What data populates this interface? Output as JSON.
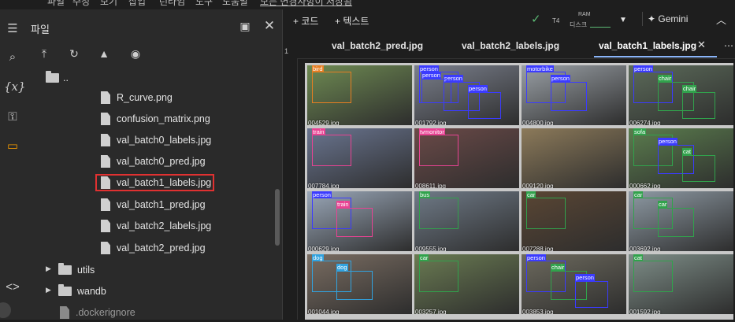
{
  "menu": [
    "파일",
    "수정",
    "보기",
    "삽입",
    "런타임",
    "도구",
    "도움말",
    "모든 변경사항이 저장됨"
  ],
  "rail_icons": [
    "list-icon",
    "search-icon",
    "variables-icon",
    "key-icon",
    "folder-icon",
    "code-icon"
  ],
  "files_panel": {
    "title": "파일",
    "parent": "..",
    "files": [
      "R_curve.png",
      "confusion_matrix.png",
      "val_batch0_labels.jpg",
      "val_batch0_pred.jpg",
      "val_batch1_labels.jpg",
      "val_batch1_pred.jpg",
      "val_batch2_labels.jpg",
      "val_batch2_pred.jpg"
    ],
    "folders": [
      "utils",
      "wandb"
    ],
    "hidden_file": ".dockerignore"
  },
  "toolbar": {
    "code_label": "+ 코드",
    "text_label": "+ 텍스트",
    "runtime": "T4",
    "ram_label": "RAM",
    "disk_label": "디스크",
    "gemini_label": "Gemini"
  },
  "tabs": [
    {
      "label": "val_batch2_pred.jpg"
    },
    {
      "label": "val_batch2_labels.jpg"
    },
    {
      "label": "val_batch1_labels.jpg"
    }
  ],
  "gutter_number": "1",
  "colors": {
    "accent": "#8ab4f8",
    "selection": "#e03131",
    "check": "#5bb974"
  },
  "images": [
    {
      "file": "004529.jpg",
      "bg": "#6e8a52",
      "labels": [
        {
          "t": "bird",
          "c": "#e67e22"
        }
      ]
    },
    {
      "file": "001792.jpg",
      "bg": "#7a7f8c",
      "labels": [
        {
          "t": "person",
          "c": "#3b3bff"
        },
        {
          "t": "person",
          "c": "#3b3bff"
        },
        {
          "t": "person",
          "c": "#3b3bff"
        },
        {
          "t": "person",
          "c": "#3b3bff"
        }
      ]
    },
    {
      "file": "004800.jpg",
      "bg": "#9aa0a6",
      "labels": [
        {
          "t": "motorbike",
          "c": "#3b3bff"
        },
        {
          "t": "person",
          "c": "#3b3bff"
        }
      ]
    },
    {
      "file": "006274.jpg",
      "bg": "#5c6b5a",
      "labels": [
        {
          "t": "person",
          "c": "#3b3bff"
        },
        {
          "t": "chair",
          "c": "#31a24c"
        },
        {
          "t": "chair",
          "c": "#31a24c"
        }
      ]
    },
    {
      "file": "007784.jpg",
      "bg": "#6a7590",
      "labels": [
        {
          "t": "train",
          "c": "#e84393"
        }
      ]
    },
    {
      "file": "008611.jpg",
      "bg": "#6b4a48",
      "labels": [
        {
          "t": "tvmonitor",
          "c": "#e84393"
        }
      ]
    },
    {
      "file": "009120.jpg",
      "bg": "#8c7a5a",
      "labels": []
    },
    {
      "file": "000662.jpg",
      "bg": "#5b7d4e",
      "labels": [
        {
          "t": "sofa",
          "c": "#31a24c"
        },
        {
          "t": "person",
          "c": "#3b3bff"
        },
        {
          "t": "cat",
          "c": "#31a24c"
        }
      ]
    },
    {
      "file": "000629.jpg",
      "bg": "#9aa7b8",
      "labels": [
        {
          "t": "person",
          "c": "#3b3bff"
        },
        {
          "t": "train",
          "c": "#e84393"
        }
      ]
    },
    {
      "file": "009555.jpg",
      "bg": "#6f7a87",
      "labels": [
        {
          "t": "bus",
          "c": "#31a24c"
        }
      ]
    },
    {
      "file": "007288.jpg",
      "bg": "#5a4634",
      "labels": [
        {
          "t": "car",
          "c": "#31a24c"
        }
      ]
    },
    {
      "file": "003692.jpg",
      "bg": "#8e9aa4",
      "labels": [
        {
          "t": "car",
          "c": "#31a24c"
        },
        {
          "t": "car",
          "c": "#31a24c"
        }
      ]
    },
    {
      "file": "001044.jpg",
      "bg": "#7a6d62",
      "labels": [
        {
          "t": "dog",
          "c": "#31a3e0"
        },
        {
          "t": "dog",
          "c": "#31a3e0"
        }
      ]
    },
    {
      "file": "003257.jpg",
      "bg": "#6a7b52",
      "labels": [
        {
          "t": "car",
          "c": "#31a24c"
        }
      ]
    },
    {
      "file": "003853.jpg",
      "bg": "#6d6a5e",
      "labels": [
        {
          "t": "person",
          "c": "#3b3bff"
        },
        {
          "t": "chair",
          "c": "#31a24c"
        },
        {
          "t": "person",
          "c": "#3b3bff"
        }
      ]
    },
    {
      "file": "001592.jpg",
      "bg": "#7e8e88",
      "labels": [
        {
          "t": "cat",
          "c": "#31a24c"
        }
      ]
    }
  ]
}
